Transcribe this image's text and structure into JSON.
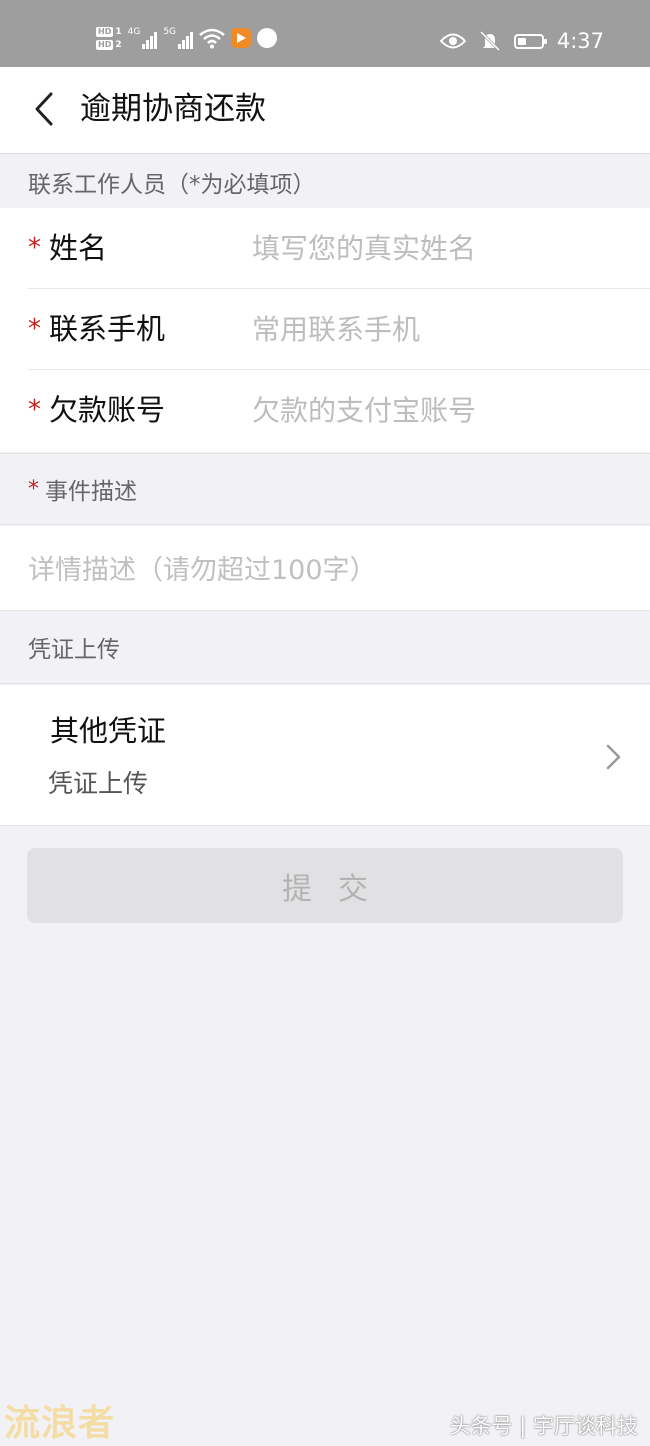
{
  "status_bar": {
    "sim1": "HD",
    "sim1_num": "1",
    "sim2": "HD",
    "sim2_num": "2",
    "net1": "4G",
    "net2": "5G",
    "time": "4:37",
    "battery_level": 0.35
  },
  "nav": {
    "title": "逾期协商还款"
  },
  "contact_section": {
    "header": "联系工作人员（*为必填项）",
    "required_mark": "*",
    "fields": [
      {
        "label": "姓名",
        "placeholder": "填写您的真实姓名",
        "value": ""
      },
      {
        "label": "联系手机",
        "placeholder": "常用联系手机",
        "value": ""
      },
      {
        "label": "欠款账号",
        "placeholder": "欠款的支付宝账号",
        "value": ""
      }
    ]
  },
  "description_section": {
    "header": "事件描述",
    "required_mark": "*",
    "placeholder": "详情描述（请勿超过100字）",
    "value": ""
  },
  "upload_section": {
    "header": "凭证上传",
    "item_title": "其他凭证",
    "item_subtitle": "凭证上传"
  },
  "submit": {
    "label": "提交"
  },
  "watermarks": {
    "left": "流浪者",
    "right": "头条号 | 宇厅谈科技"
  },
  "colors": {
    "required": "#c8201f",
    "page_background": "#f2f2f6",
    "submit_disabled": "#e1e1e4"
  }
}
